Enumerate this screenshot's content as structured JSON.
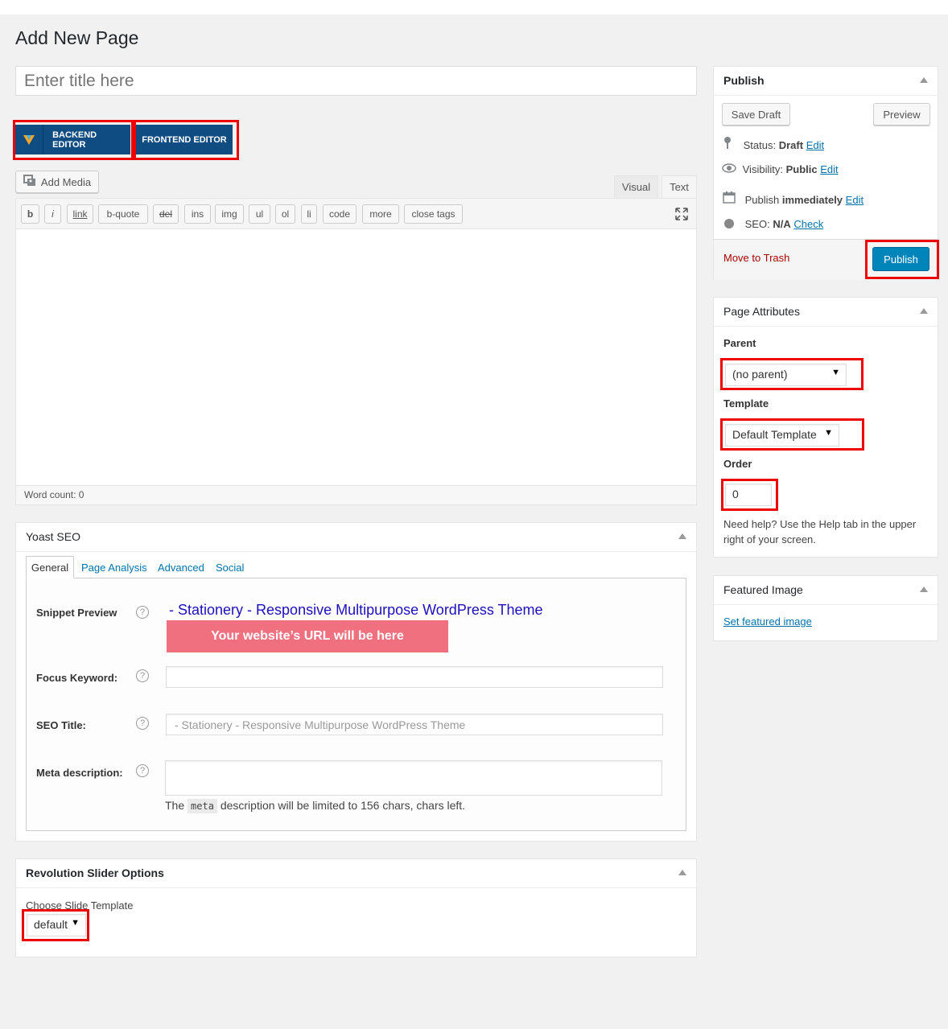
{
  "page": {
    "title": "Add New Page"
  },
  "title_input": {
    "placeholder": "Enter title here"
  },
  "vc": {
    "backend": "BACKEND EDITOR",
    "frontend": "FRONTEND EDITOR"
  },
  "editor": {
    "add_media": "Add Media",
    "tabs": [
      "Visual",
      "Text"
    ],
    "quicktags": [
      "b",
      "i",
      "link",
      "b-quote",
      "del",
      "ins",
      "img",
      "ul",
      "ol",
      "li",
      "code",
      "more",
      "close tags"
    ],
    "word_count": "Word count: 0"
  },
  "publish": {
    "title": "Publish",
    "save_draft": "Save Draft",
    "preview": "Preview",
    "status_label": "Status:",
    "status_value": "Draft",
    "visibility_label": "Visibility:",
    "visibility_value": "Public",
    "publish_label": "Publish",
    "publish_value": "immediately",
    "seo_label": "SEO:",
    "seo_value": "N/A",
    "edit": "Edit",
    "check": "Check",
    "move_trash": "Move to Trash",
    "publish_btn": "Publish"
  },
  "attributes": {
    "title": "Page Attributes",
    "parent_label": "Parent",
    "parent_value": "(no parent)",
    "template_label": "Template",
    "template_value": "Default Template",
    "order_label": "Order",
    "order_value": "0",
    "help": "Need help? Use the Help tab in the upper right of your screen."
  },
  "featured": {
    "title": "Featured Image",
    "link": "Set featured image"
  },
  "yoast": {
    "title": "Yoast SEO",
    "tabs": [
      "General",
      "Page Analysis",
      "Advanced",
      "Social"
    ],
    "snippet_label": "Snippet Preview",
    "snippet_title": "- Stationery - Responsive Multipurpose WordPress Theme",
    "snippet_url": "Your website’s URL will be here",
    "focus_label": "Focus Keyword:",
    "seo_title_label": "SEO Title:",
    "seo_title_placeholder": "- Stationery - Responsive Multipurpose WordPress Theme",
    "meta_label": "Meta description:",
    "meta_note_pre": "The",
    "meta_code": "meta",
    "meta_note_post": "description will be limited to 156 chars, chars left.",
    "help": "?"
  },
  "revslider": {
    "title": "Revolution Slider Options",
    "label": "Choose Slide Template",
    "value": "default"
  },
  "colors": {
    "publish_btn": "#0085ba",
    "vc_blue": "#0f4c81",
    "url_bar": "#f0707f",
    "highlight": "#e00000"
  }
}
